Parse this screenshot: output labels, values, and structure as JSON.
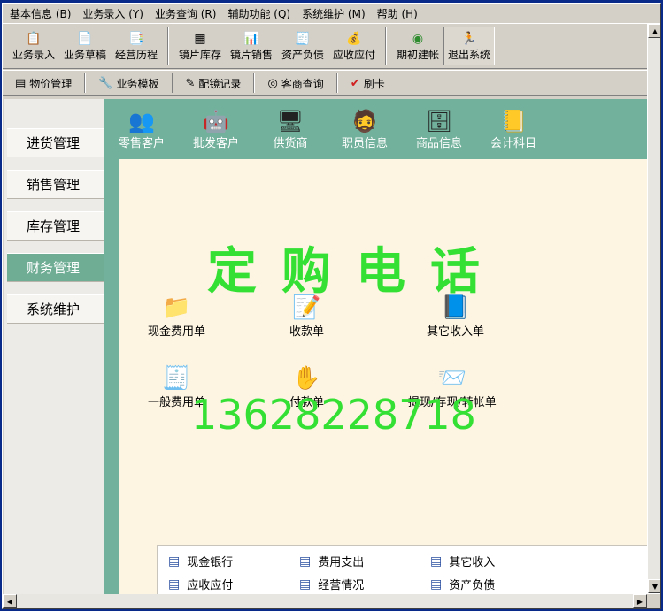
{
  "menubar": {
    "items": [
      "基本信息 (B)",
      "业务录入 (Y)",
      "业务查询 (R)",
      "辅助功能 (Q)",
      "系统维护 (M)",
      "帮助 (H)"
    ]
  },
  "toolbar1": {
    "buttons": [
      {
        "label": "业务录入",
        "icon": "entry-icon"
      },
      {
        "label": "业务草稿",
        "icon": "draft-icon"
      },
      {
        "label": "经营历程",
        "icon": "history-icon"
      },
      {
        "label": "镜片库存",
        "icon": "lens-stock-icon"
      },
      {
        "label": "镜片销售",
        "icon": "lens-sales-icon"
      },
      {
        "label": "资产负债",
        "icon": "balance-icon"
      },
      {
        "label": "应收应付",
        "icon": "receivable-icon"
      },
      {
        "label": "期初建帐",
        "icon": "opening-account-icon"
      },
      {
        "label": "退出系统",
        "icon": "exit-runner-icon"
      }
    ]
  },
  "toolbar2": {
    "buttons": [
      {
        "label": "物价管理",
        "icon": "price-icon"
      },
      {
        "label": "业务模板",
        "icon": "template-icon"
      },
      {
        "label": "配镜记录",
        "icon": "glasses-record-icon"
      },
      {
        "label": "客商查询",
        "icon": "query-icon"
      },
      {
        "label": "刷卡",
        "icon": "checkmark-icon"
      }
    ]
  },
  "leftnav": {
    "items": [
      "进货管理",
      "销售管理",
      "库存管理",
      "财务管理",
      "系统维护"
    ],
    "active": "财务管理"
  },
  "iconbar": {
    "items": [
      "零售客户",
      "批发客户",
      "供货商",
      "职员信息",
      "商品信息",
      "会计科目"
    ]
  },
  "watermark": {
    "title": "定购电话",
    "phone": "13628228718"
  },
  "docs": {
    "cash_expense": "现金费用单",
    "receipt": "收款单",
    "other_income": "其它收入单",
    "general_expense": "一般费用单",
    "payment": "付款单",
    "withdraw_deposit_transfer": "提现/存现/转帐单"
  },
  "links": {
    "items": [
      "现金银行",
      "费用支出",
      "其它收入",
      "应收应付",
      "经营情况",
      "资产负债"
    ]
  },
  "colors": {
    "frame_green": "#72b19b",
    "panel_bg": "#fdf4e2",
    "watermark_green": "#33e033",
    "title_blue": "#0a2a8a"
  }
}
